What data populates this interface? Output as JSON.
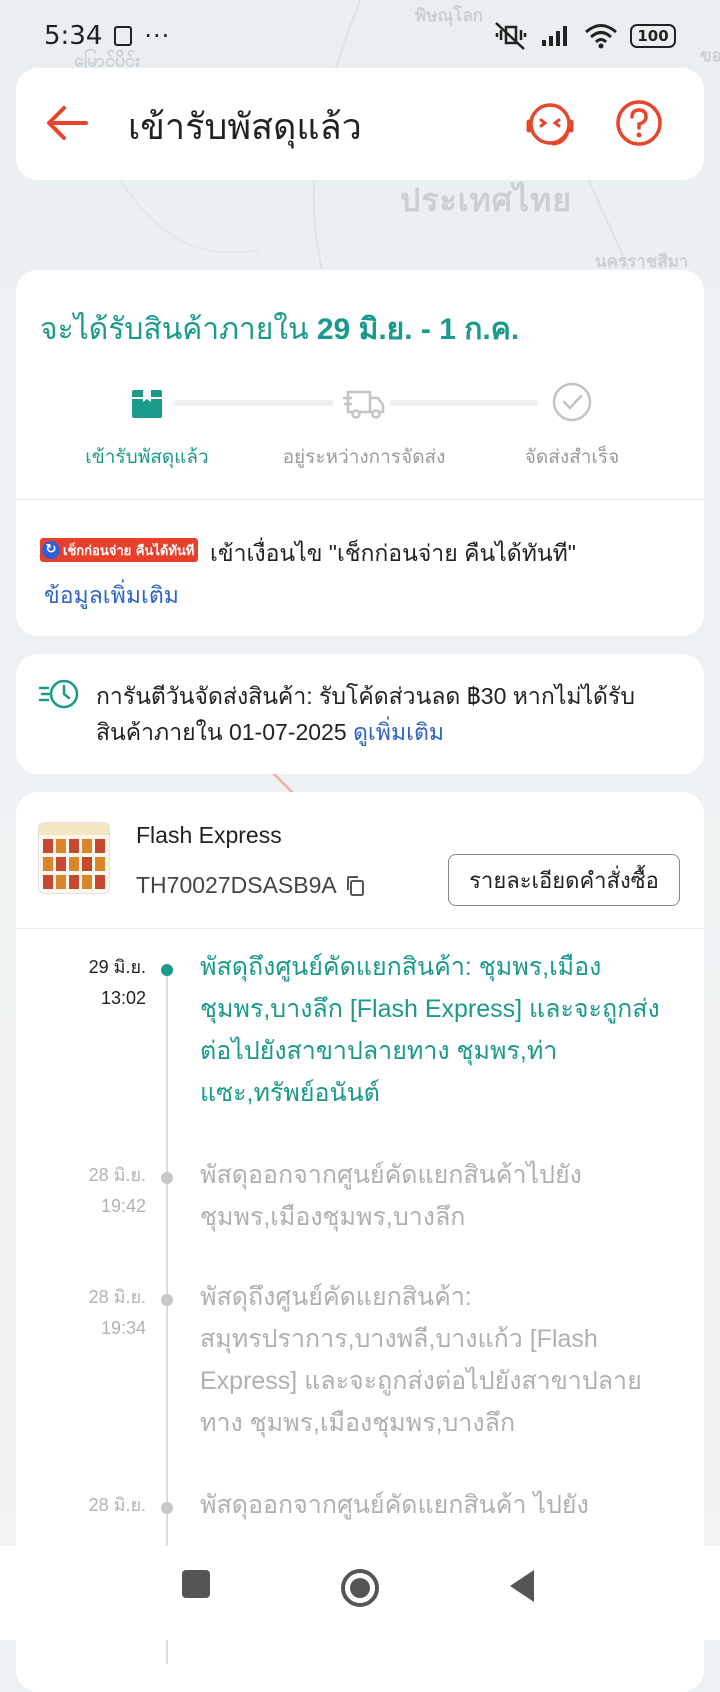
{
  "status_bar": {
    "time": "5:34",
    "more": "···",
    "battery": "100"
  },
  "map": {
    "labels": [
      "ประเทศไทย",
      "พิษณุโลก",
      "นครราชสีมา",
      "မြောင်ပိုင်း",
      "ขอ"
    ]
  },
  "header": {
    "title": "เข้ารับพัสดุแล้ว",
    "accent_color": "#e8452c"
  },
  "delivery": {
    "eta_prefix": "จะได้รับสินค้าภายใน",
    "eta_range": "29 มิ.ย. - 1 ก.ค.",
    "accent_color": "#1a9a8b",
    "steps": [
      {
        "label": "เข้ารับพัสดุแล้ว",
        "state": "done",
        "icon": "package-icon"
      },
      {
        "label": "อยู่ระหว่างการจัดส่ง",
        "state": "pending",
        "icon": "truck-icon"
      },
      {
        "label": "จัดส่งสำเร็จ",
        "state": "pending",
        "icon": "check-circle-icon"
      }
    ],
    "policy_badge": "เช็กก่อนจ่าย คืนได้ทันที",
    "policy_text": "เข้าเงื่อนไข \"เช็กก่อนจ่าย คืนได้ทันที\"",
    "more_info": "ข้อมูลเพิ่มเติม"
  },
  "guarantee": {
    "text": "การันตีวันจัดส่งสินค้า: รับโค้ดส่วนลด ฿30 หากไม่ได้รับสินค้าภายใน 01-07-2025",
    "link": "ดูเพิ่มเติม"
  },
  "shipment": {
    "carrier": "Flash Express",
    "tracking_number": "TH70027DSASB9A",
    "order_details_button": "รายละเอียดคำสั่งซื้อ",
    "events": [
      {
        "date": "29 มิ.ย.",
        "time": "13:02",
        "text": "พัสดุถึงศูนย์คัดแยกสินค้า: ชุมพร,เมืองชุมพร,บางลึก  [Flash Express] และจะถูกส่งต่อไปยังสาขาปลายทาง ชุมพร,ท่าแซะ,ทรัพย์อนันต์",
        "active": true
      },
      {
        "date": "28 มิ.ย.",
        "time": "19:42",
        "text": "พัสดุออกจากศูนย์คัดแยกสินค้าไปยัง ชุมพร,เมืองชุมพร,บางลึก",
        "active": false
      },
      {
        "date": "28 มิ.ย.",
        "time": "19:34",
        "text": "พัสดุถึงศูนย์คัดแยกสินค้า: สมุทรปราการ,บางพลี,บางแก้ว  [Flash Express] และจะถูกส่งต่อไปยังสาขาปลายทาง ชุมพร,เมืองชุมพร,บางลึก",
        "active": false
      },
      {
        "date": "28 มิ.ย.",
        "time": "",
        "text": "พัสดุออกจากศูนย์คัดแยกสินค้า ไปยัง",
        "active": false
      }
    ]
  }
}
